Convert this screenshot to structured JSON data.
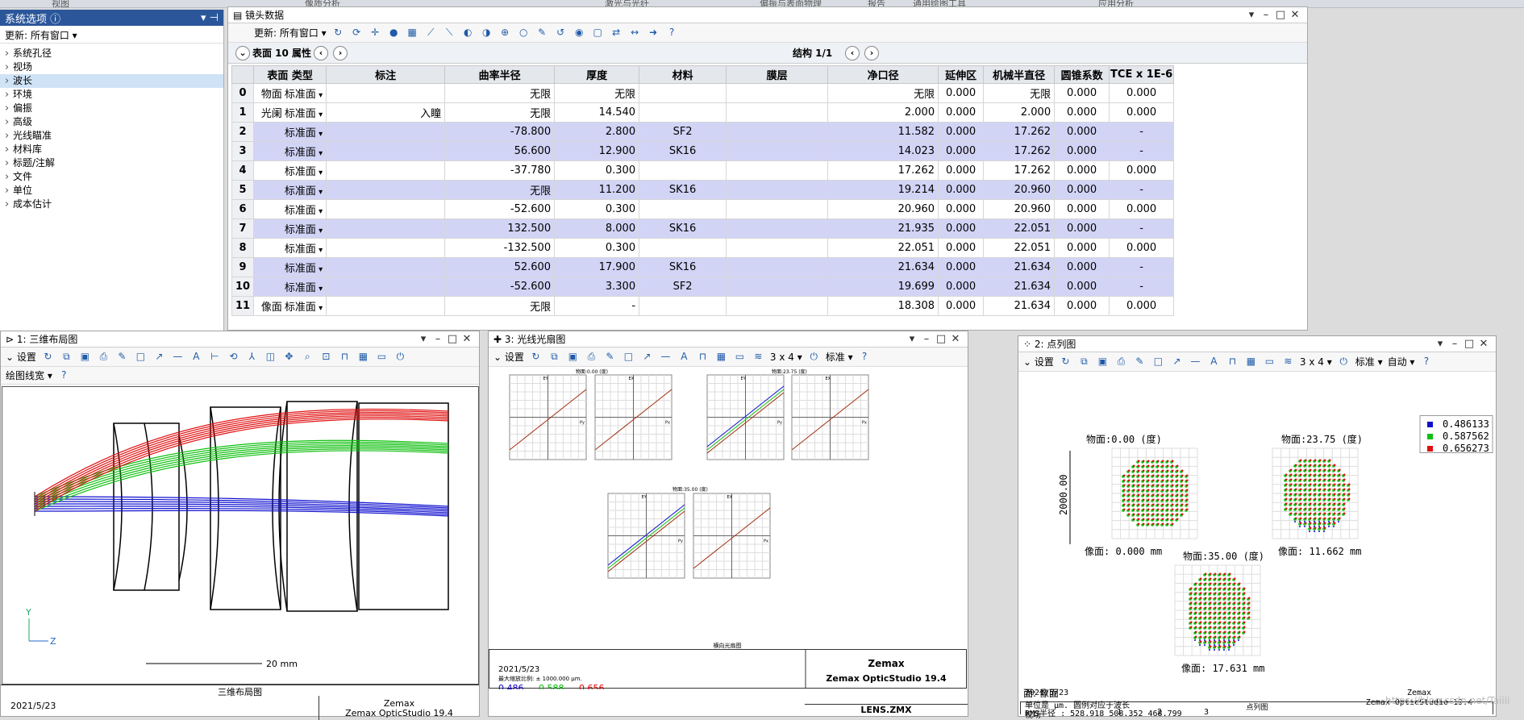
{
  "top_ribbon": [
    "视图",
    "像质分析",
    "激光与光纤",
    "偏振与表面物理",
    "报告",
    "通用绘图工具",
    "应用分析"
  ],
  "system": {
    "title": "系统选项",
    "update_label": "更新: 所有窗口",
    "items": [
      "系统孔径",
      "视场",
      "波长",
      "环境",
      "偏振",
      "高级",
      "光线瞄准",
      "材料库",
      "标题/注解",
      "文件",
      "单位",
      "成本估计"
    ],
    "selected": 2
  },
  "lens": {
    "title": "镜头数据",
    "update_label": "更新: 所有窗口",
    "surface_label": "表面 10 属性",
    "structure_label": "结构 1/1",
    "columns": [
      "表面 类型",
      "标注",
      "曲率半径",
      "厚度",
      "材料",
      "膜层",
      "净口径",
      "延伸区",
      "机械半直径",
      "圆锥系数",
      "TCE x 1E-6"
    ],
    "rows": [
      {
        "n": "0",
        "name": "物面",
        "type": "标准面",
        "note": "",
        "radius": "无限",
        "thick": "无限",
        "mat": "",
        "coat": "",
        "clear": "无限",
        "ext": "0.000",
        "mech": "无限",
        "conic": "0.000",
        "tce": "0.000",
        "hl": false
      },
      {
        "n": "1",
        "name": "光阑",
        "type": "标准面",
        "note": "入瞳",
        "radius": "无限",
        "thick": "14.540",
        "mat": "",
        "coat": "",
        "clear": "2.000",
        "ext": "0.000",
        "mech": "2.000",
        "conic": "0.000",
        "tce": "0.000",
        "hl": false
      },
      {
        "n": "2",
        "name": "",
        "type": "标准面",
        "note": "",
        "radius": "-78.800",
        "thick": "2.800",
        "mat": "SF2",
        "coat": "",
        "clear": "11.582",
        "ext": "0.000",
        "mech": "17.262",
        "conic": "0.000",
        "tce": "-",
        "hl": true
      },
      {
        "n": "3",
        "name": "",
        "type": "标准面",
        "note": "",
        "radius": "56.600",
        "thick": "12.900",
        "mat": "SK16",
        "coat": "",
        "clear": "14.023",
        "ext": "0.000",
        "mech": "17.262",
        "conic": "0.000",
        "tce": "-",
        "hl": true
      },
      {
        "n": "4",
        "name": "",
        "type": "标准面",
        "note": "",
        "radius": "-37.780",
        "thick": "0.300",
        "mat": "",
        "coat": "",
        "clear": "17.262",
        "ext": "0.000",
        "mech": "17.262",
        "conic": "0.000",
        "tce": "0.000",
        "hl": false
      },
      {
        "n": "5",
        "name": "",
        "type": "标准面",
        "note": "",
        "radius": "无限",
        "thick": "11.200",
        "mat": "SK16",
        "coat": "",
        "clear": "19.214",
        "ext": "0.000",
        "mech": "20.960",
        "conic": "0.000",
        "tce": "-",
        "hl": true
      },
      {
        "n": "6",
        "name": "",
        "type": "标准面",
        "note": "",
        "radius": "-52.600",
        "thick": "0.300",
        "mat": "",
        "coat": "",
        "clear": "20.960",
        "ext": "0.000",
        "mech": "20.960",
        "conic": "0.000",
        "tce": "0.000",
        "hl": false
      },
      {
        "n": "7",
        "name": "",
        "type": "标准面",
        "note": "",
        "radius": "132.500",
        "thick": "8.000",
        "mat": "SK16",
        "coat": "",
        "clear": "21.935",
        "ext": "0.000",
        "mech": "22.051",
        "conic": "0.000",
        "tce": "-",
        "hl": true
      },
      {
        "n": "8",
        "name": "",
        "type": "标准面",
        "note": "",
        "radius": "-132.500",
        "thick": "0.300",
        "mat": "",
        "coat": "",
        "clear": "22.051",
        "ext": "0.000",
        "mech": "22.051",
        "conic": "0.000",
        "tce": "0.000",
        "hl": false
      },
      {
        "n": "9",
        "name": "",
        "type": "标准面",
        "note": "",
        "radius": "52.600",
        "thick": "17.900",
        "mat": "SK16",
        "coat": "",
        "clear": "21.634",
        "ext": "0.000",
        "mech": "21.634",
        "conic": "0.000",
        "tce": "-",
        "hl": true
      },
      {
        "n": "10",
        "name": "",
        "type": "标准面",
        "note": "",
        "radius": "-52.600",
        "thick": "3.300",
        "mat": "SF2",
        "coat": "",
        "clear": "19.699",
        "ext": "0.000",
        "mech": "21.634",
        "conic": "0.000",
        "tce": "-",
        "hl": true
      },
      {
        "n": "11",
        "name": "像面",
        "type": "标准面",
        "note": "",
        "radius": "无限",
        "thick": "-",
        "mat": "",
        "coat": "",
        "clear": "18.308",
        "ext": "0.000",
        "mech": "21.634",
        "conic": "0.000",
        "tce": "0.000",
        "hl": false
      }
    ]
  },
  "layout3d": {
    "title": "1: 三维布局图",
    "settings": "设置",
    "linewidth": "绘图线宽",
    "scale_label": "20 mm",
    "caption": "三维布局图",
    "date": "2021/5/23",
    "company": "Zemax",
    "product": "Zemax OpticStudio 19.4",
    "axis_y": "Y",
    "axis_z": "Z"
  },
  "fan": {
    "title": "3: 光线光扇图",
    "settings": "设置",
    "grid": "3 x 4",
    "std": "标准",
    "plot_labels": [
      "物面:0.00 (度)",
      "物面:23.75 (度)",
      "物面:35.00 (度)"
    ],
    "ey": "EY",
    "ex": "EX",
    "py": "Py",
    "px": "Px",
    "caption": "横向光扇图",
    "date": "2021/5/23",
    "scale_note": "最大缩放比例: ± 1000.000 μm.",
    "wavelengths": [
      "0.486",
      "0.588",
      "0.656"
    ],
    "company": "Zemax",
    "product": "Zemax OpticStudio 19.4",
    "file": "LENS.ZMX"
  },
  "spot": {
    "title": "2: 点列图",
    "settings": "设置",
    "grid": "3 x 4",
    "std": "标准",
    "auto": "自动",
    "legend": [
      "0.486133",
      "0.587562",
      "0.656273"
    ],
    "f1": "物面:0.00 (度)",
    "f2": "物面:23.75 (度)",
    "f3": "物面:35.00 (度)",
    "i1": "像面: 0.000 mm",
    "i2": "像面: 11.662 mm",
    "i3": "像面: 17.631 mm",
    "scale": "2000.00",
    "surface": "面: 像面",
    "caption": "点列图",
    "date": "2021/5/23",
    "unit_note": "单位是 μm. 圆例对应于波长",
    "field_label": "视场",
    "field_nums": [
      "1",
      "2",
      "3"
    ],
    "rms_label": "RMS半径 :",
    "rms": [
      "528.918",
      "508.352",
      "468.799"
    ],
    "company": "Zemax",
    "product": "Zemax OpticStudio 19.4",
    "watermark": "https://blog.csdn.net/Taiiii"
  },
  "colors": {
    "red": "#e01010",
    "green": "#10c010",
    "blue": "#1010d0",
    "highlight": "#d2d4f6",
    "brand": "#2b579a"
  }
}
